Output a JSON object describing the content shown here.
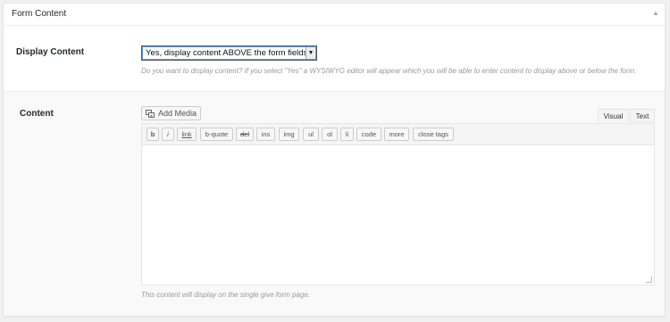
{
  "metabox": {
    "title": "Form Content"
  },
  "display_field": {
    "label": "Display Content",
    "selected_value": "Yes, display content ABOVE the form fields",
    "description": "Do you want to display content? If you select \"Yes\" a WYSIWYG editor will appear which you will be able to enter content to display above or below the form."
  },
  "content_field": {
    "label": "Content",
    "add_media_label": "Add Media",
    "tabs": {
      "visual": "Visual",
      "text": "Text"
    },
    "quicktags": [
      "b",
      "i",
      "link",
      "b-quote",
      "del",
      "ins",
      "img",
      "ul",
      "ol",
      "li",
      "code",
      "more",
      "close tags"
    ],
    "description": "This content will display on the single give form page."
  }
}
